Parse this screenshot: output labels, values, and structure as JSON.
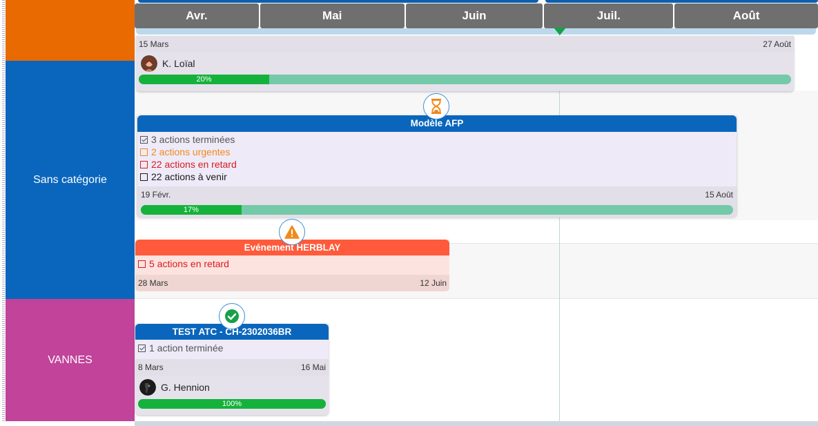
{
  "categories": [
    {
      "label": ""
    },
    {
      "label": "Sans catégorie"
    },
    {
      "label": "VANNES"
    }
  ],
  "months": [
    "Avr.",
    "Mai",
    "Juin",
    "Juil.",
    "Août"
  ],
  "colors": {
    "progress_fill": "#15b23b",
    "progress_track": "#74c9a8",
    "blue_header": "#0a66bd",
    "red_header": "#ff5a3b",
    "today": "#17a04a"
  },
  "project1": {
    "start_date": "15 Mars",
    "end_date": "27 Août",
    "owner": "K. Loïal",
    "progress_label": "20%",
    "progress": 0.2
  },
  "project2": {
    "status_icon": "hourglass-icon",
    "title": "Modèle AFP",
    "actions": [
      {
        "text": "3 actions terminées",
        "color": "#555555",
        "checked": true
      },
      {
        "text": "2 actions urgentes",
        "color": "#f08a1c",
        "checked": false
      },
      {
        "text": "22 actions en retard",
        "color": "#d81b1b",
        "checked": false
      },
      {
        "text": "22 actions à venir",
        "color": "#1a1a1a",
        "checked": false
      }
    ],
    "start_date": "19 Févr.",
    "end_date": "15 Août",
    "progress_label": "17%",
    "progress": 0.17
  },
  "project3": {
    "status_icon": "warning-icon",
    "title": "Evénement HERBLAY",
    "actions": [
      {
        "text": "5 actions en retard",
        "color": "#d81b1b",
        "checked": false
      }
    ],
    "start_date": "28 Mars",
    "end_date": "12 Juin"
  },
  "project4": {
    "status_icon": "check-circle-icon",
    "title": "TEST ATC - CH-2302036BR",
    "actions": [
      {
        "text": "1 action terminée",
        "color": "#555555",
        "checked": true
      }
    ],
    "start_date": "8 Mars",
    "end_date": "16 Mai",
    "owner": "G. Hennion",
    "progress_label": "100%",
    "progress": 1.0
  }
}
